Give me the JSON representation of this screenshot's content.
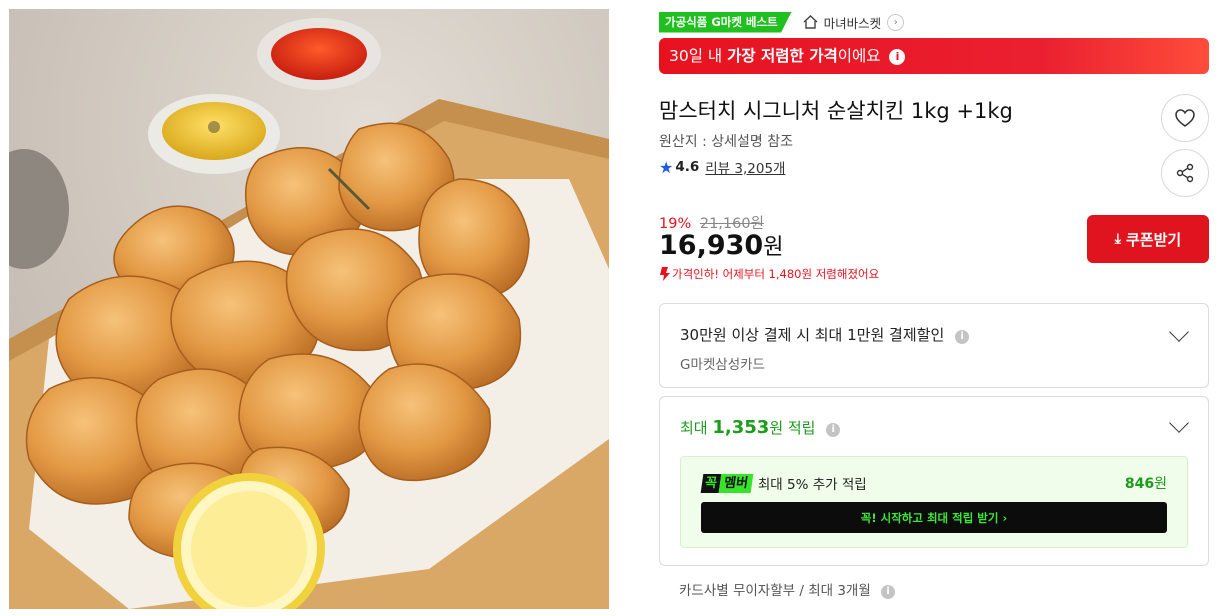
{
  "product_image": {
    "alt": ""
  },
  "tags": {
    "best_badge": "가공식품 G마켓 베스트",
    "store_name": "마녀바스켓"
  },
  "price_banner": {
    "prefix": "30일 내 ",
    "highlight": "가장 저렴한 가격",
    "suffix": "이에요"
  },
  "product": {
    "title": "맘스터치 시그니처 순살치킨 1kg +1kg",
    "origin": "원산지 : 상세설명 참조",
    "rating": "4.6",
    "review_label": "리뷰 3,205개"
  },
  "price": {
    "discount_rate": "19%",
    "original_price": "21,160원",
    "sale_price": "16,930",
    "currency": "원",
    "drop_note": "가격인하! 어제부터 1,480원 저렴해졌어요"
  },
  "coupon_button": {
    "label": "쿠폰받기"
  },
  "card_discount": {
    "main": "30만원 이상 결제 시 최대 1만원 결제할인",
    "sub": "G마켓삼성카드"
  },
  "points": {
    "prefix": "최대 ",
    "amount": "1,353",
    "suffix": "원 적립",
    "member_logo_1": "꼭",
    "member_logo_2": "멤버",
    "member_desc": "최대 5% 추가 적립",
    "member_amount": "846",
    "member_currency": "원",
    "start_button": "꼭! 시작하고 최대 적립 받기  ›"
  },
  "installment": {
    "label": "카드사별 무이자할부 / 최대 3개월"
  },
  "colors": {
    "accent_red": "#e0141e",
    "accent_green": "#1fc01f",
    "rating_blue": "#1e5ce6"
  }
}
